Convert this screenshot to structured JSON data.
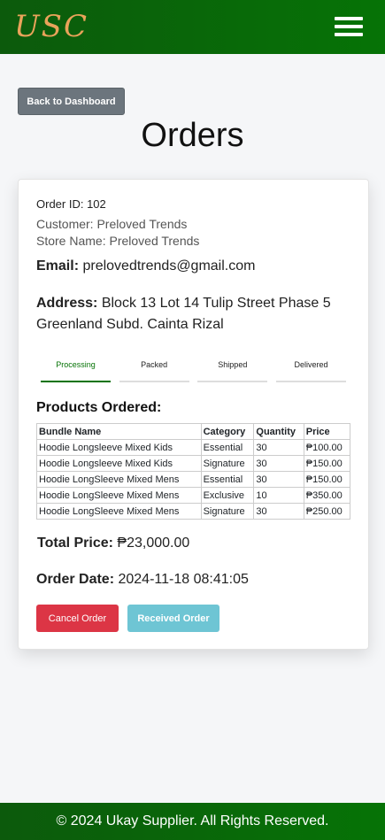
{
  "header": {
    "logo": "USC",
    "menu_icon": "hamburger-icon"
  },
  "nav": {
    "back_label": "Back to Dashboard"
  },
  "page": {
    "title": "Orders"
  },
  "order": {
    "id_text": "Order ID: 102",
    "customer_text": "Customer: Preloved Trends",
    "store_text": "Store Name: Preloved Trends",
    "email_label": "Email:",
    "email_value": "prelovedtrends@gmail.com",
    "address_label": "Address:",
    "address_value": "Block 13 Lot 14 Tulip Street Phase 5 Greenland Subd. Cainta Rizal",
    "steps": [
      "Processing",
      "Packed",
      "Shipped",
      "Delivered"
    ],
    "active_step": "Processing",
    "products_title": "Products Ordered:",
    "columns": [
      "Bundle Name",
      "Category",
      "Quantity",
      "Price"
    ],
    "rows": [
      [
        "Hoodie Longsleeve Mixed Kids",
        "Essential",
        "30",
        "₱100.00"
      ],
      [
        "Hoodie Longsleeve Mixed Kids",
        "Signature",
        "30",
        "₱150.00"
      ],
      [
        "Hoodie LongSleeve Mixed Mens",
        "Essential",
        "30",
        "₱150.00"
      ],
      [
        "Hoodie LongSleeve Mixed Mens",
        "Exclusive",
        "10",
        "₱350.00"
      ],
      [
        "Hoodie LongSleeve Mixed Mens",
        "Signature",
        "30",
        "₱250.00"
      ]
    ],
    "total_label": "Total Price:",
    "total_value": "₱23,000.00",
    "date_label": "Order Date:",
    "date_value": "2024-11-18 08:41:05",
    "cancel_label": "Cancel Order",
    "received_label": "Received Order"
  },
  "footer": {
    "text": "© 2024 Ukay Supplier. All Rights Reserved."
  },
  "colors": {
    "brand_green": "#067306",
    "logo": "#e9a35a",
    "danger": "#dc3545",
    "info": "#6ec5d4",
    "secondary": "#6c757d"
  }
}
